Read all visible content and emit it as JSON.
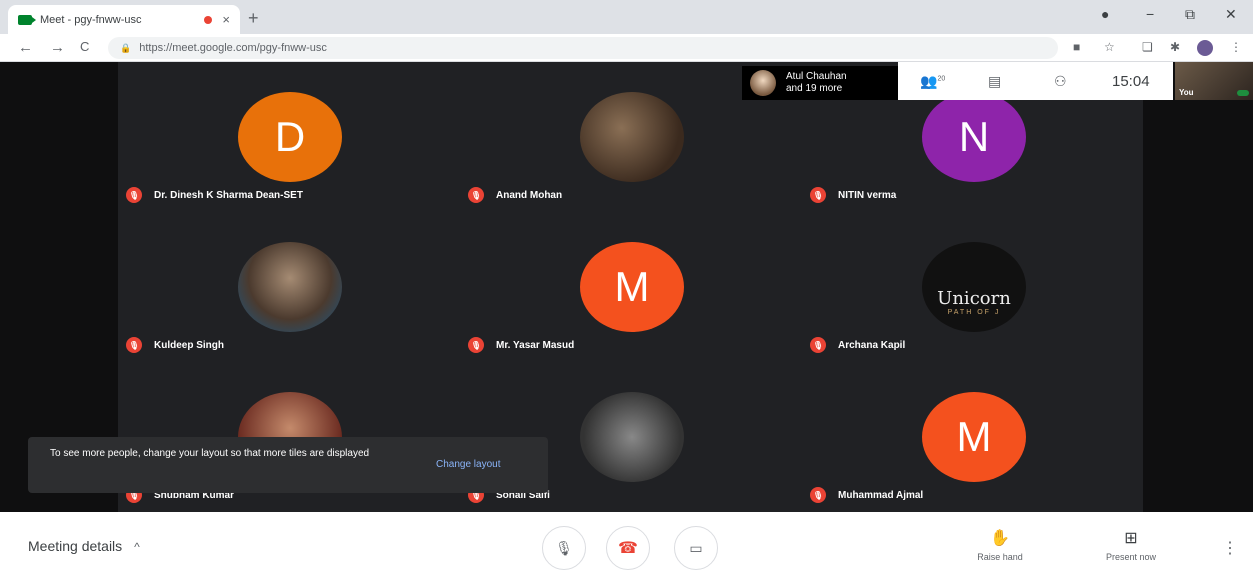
{
  "browser": {
    "tab_title": "Meet - pgy-fnww-usc",
    "tab_close": "×",
    "new_tab": "+",
    "url": "https://meet.google.com/pgy-fnww-usc",
    "window_controls": [
      "●",
      "−",
      "⧉",
      "✕"
    ],
    "nav": {
      "back": "←",
      "forward": "→",
      "reload": "C"
    },
    "extensions": [
      "■",
      "☆",
      "❏",
      "✱"
    ]
  },
  "participants_pill": {
    "text_line1": "Atul Chauhan",
    "text_line2": "and 19 more"
  },
  "toolbar_top": {
    "people_count": "20",
    "clock": "15:04"
  },
  "self_view": {
    "label": "You"
  },
  "tiles": [
    {
      "name": "Dr. Dinesh K Sharma Dean-SET",
      "initial": "D",
      "color": "#e8710a"
    },
    {
      "name": "Anand Mohan",
      "initial": "",
      "color": ""
    },
    {
      "name": "NITIN verma",
      "initial": "N",
      "color": "#8e24aa"
    },
    {
      "name": "Kuldeep Singh",
      "initial": "",
      "color": ""
    },
    {
      "name": "Mr. Yasar Masud",
      "initial": "M",
      "color": "#f4511e"
    },
    {
      "name": "Archana Kapil",
      "initial": "",
      "color": ""
    },
    {
      "name": "Shubham Kumar",
      "initial": "",
      "color": ""
    },
    {
      "name": "Sohail Saifi",
      "initial": "",
      "color": ""
    },
    {
      "name": "Muhammad Ajmal",
      "initial": "M",
      "color": "#f4511e"
    }
  ],
  "unicorn": {
    "title": "Unicorn",
    "subtitle": "PATH OF J"
  },
  "toast": {
    "message": "To see more people, change your layout so that more tiles are displayed",
    "action": "Change layout"
  },
  "bottom": {
    "meeting_details": "Meeting details",
    "raise_hand": "Raise hand",
    "present_now": "Present now"
  }
}
